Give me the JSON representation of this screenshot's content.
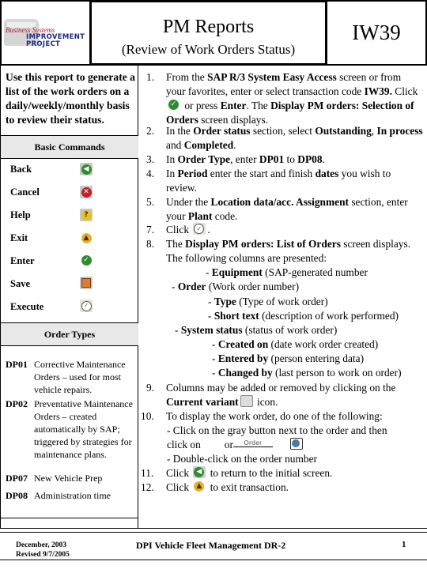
{
  "header": {
    "logo": {
      "script_text": "Business Systems",
      "line1": "IMPROVEMENT",
      "line2": "PROJECT"
    },
    "title": "PM Reports",
    "subtitle": "(Review of Work Orders Status)",
    "transaction_code": "IW39"
  },
  "intro": "Use this report to generate a list of the work orders on a daily/weekly/monthly basis to review their status.",
  "basic_commands": {
    "heading": "Basic Commands",
    "items": [
      {
        "label": "Back",
        "icon": "back-icon",
        "color": "#2e8b2e"
      },
      {
        "label": "Cancel",
        "icon": "cancel-icon",
        "color": "#c0202a"
      },
      {
        "label": "Help",
        "icon": "help-icon",
        "color": "#e8c020"
      },
      {
        "label": "Exit",
        "icon": "exit-icon",
        "color": "#e8b020"
      },
      {
        "label": "Enter",
        "icon": "enter-icon",
        "color": "#2e8b2e"
      },
      {
        "label": "Save",
        "icon": "save-icon",
        "color": "#d88030"
      },
      {
        "label": "Execute",
        "icon": "execute-icon",
        "color": "#7a9a40"
      }
    ]
  },
  "order_types": {
    "heading": "Order Types",
    "items": [
      {
        "code": "DP01",
        "description": "Corrective Maintenance Orders – used for most vehicle repairs."
      },
      {
        "code": "DP02",
        "description": "Preventative Maintenance Orders – created automatically by SAP; triggered by strategies for maintenance plans."
      },
      {
        "code": "DP07",
        "description": "New Vehicle Prep"
      },
      {
        "code": "DP08",
        "description": "Administration time"
      }
    ]
  },
  "steps": {
    "s1": {
      "num": "1.",
      "a": "From the ",
      "b": "SAP R/3 System Easy Access",
      "c": " screen or from your favorites, enter or select transaction code ",
      "d": "IW39.",
      "e": " Click ",
      "f": " or press ",
      "g": "Enter",
      "h": ".  The ",
      "i": "Display PM orders: Selection of Orders",
      "j": " screen displays."
    },
    "s2": {
      "num": "2.",
      "a": "In the ",
      "b": "Order status",
      "c": " section, select ",
      "d": "Outstanding",
      "e": ", ",
      "f": "In process",
      "g": " and ",
      "h": "Completed",
      "i": "."
    },
    "s3": {
      "num": "3.",
      "a": "In ",
      "b": "Order Type",
      "c": ", enter ",
      "d": "DP01",
      "e": " to ",
      "f": "DP08",
      "g": "."
    },
    "s4": {
      "num": "4.",
      "a": "In ",
      "b": "Period",
      "c": " enter the start and finish ",
      "d": "dates",
      "e": " you wish to review."
    },
    "s5": {
      "num": "5.",
      "a": "Under the ",
      "b": "Location data/acc. Assignment",
      "c": " section, enter your ",
      "d": "Plant",
      "e": " code."
    },
    "s7": {
      "num": "7.",
      "a": "Click ",
      "b": "."
    },
    "s8": {
      "num": "8.",
      "a": "The ",
      "b": "Display PM orders: List of Orders",
      "c": " screen displays. The following columns are presented:"
    },
    "columns": [
      {
        "name": "Equipment",
        "desc": " (SAP-generated number"
      },
      {
        "name": "Order",
        "desc": " (Work order number)"
      },
      {
        "name": "Type",
        "desc": " (Type of work order)"
      },
      {
        "name": "Short text",
        "desc": " (description of work performed)"
      },
      {
        "name": "System status",
        "desc": " (status of work order)"
      },
      {
        "name": "Created on",
        "desc": " (date work order created)"
      },
      {
        "name": "Entered by",
        "desc": " (person entering data)"
      },
      {
        "name": "Changed by",
        "desc": " (last person to work on order)"
      }
    ],
    "column_prefix": "- ",
    "s9": {
      "num": "9.",
      "a": "Columns may be added or removed by clicking on the ",
      "b": "Current variant",
      "c": " icon."
    },
    "s10": {
      "num": "10.",
      "a": "To display the work order, do one of the following:",
      "b": "- Click on the gray button next to the order and then click on",
      "c": "or",
      "order_btn": "Order",
      "d": "- Double-click on the order number"
    },
    "s11": {
      "num": "11.",
      "a": "Click ",
      "b": " to return to the initial screen."
    },
    "s12": {
      "num": "12.",
      "a": "Click ",
      "b": " to exit transaction."
    }
  },
  "footer": {
    "date": "December, 2003",
    "revised": "Revised 9/7/2005",
    "center": "DPI Vehicle Fleet Management  DR-2",
    "page": "1"
  }
}
